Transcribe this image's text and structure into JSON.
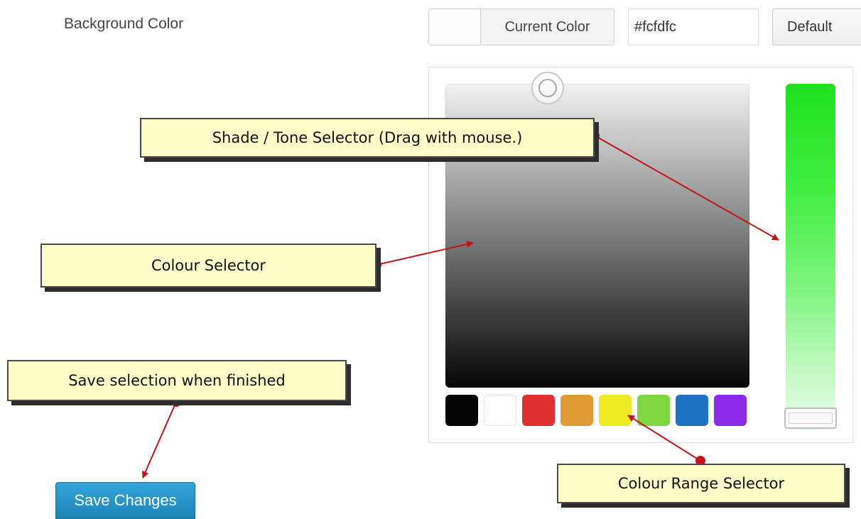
{
  "setting": {
    "label": "Background Color",
    "current_color_label": "Current Color",
    "current_color_value": "#fcfdfc",
    "hex_value": "#fcfdfc",
    "default_label": "Default"
  },
  "picker": {
    "palette": [
      {
        "name": "black",
        "color": "#050505"
      },
      {
        "name": "white",
        "color": "#ffffff"
      },
      {
        "name": "red",
        "color": "#e03030"
      },
      {
        "name": "orange",
        "color": "#e09a38"
      },
      {
        "name": "yellow",
        "color": "#eeea22"
      },
      {
        "name": "green",
        "color": "#80d640"
      },
      {
        "name": "blue",
        "color": "#1e72c2"
      },
      {
        "name": "purple",
        "color": "#8a2be8"
      }
    ],
    "hue_color": "#20e020"
  },
  "annotations": {
    "shade": "Shade / Tone Selector (Drag with mouse.)",
    "colour": "Colour Selector",
    "save": "Save selection when finished",
    "range": "Colour Range Selector"
  },
  "actions": {
    "save_label": "Save Changes"
  },
  "colors": {
    "arrow": "#c0151b",
    "callout_bg": "#fffdc9",
    "save_button": "#2791c8"
  }
}
